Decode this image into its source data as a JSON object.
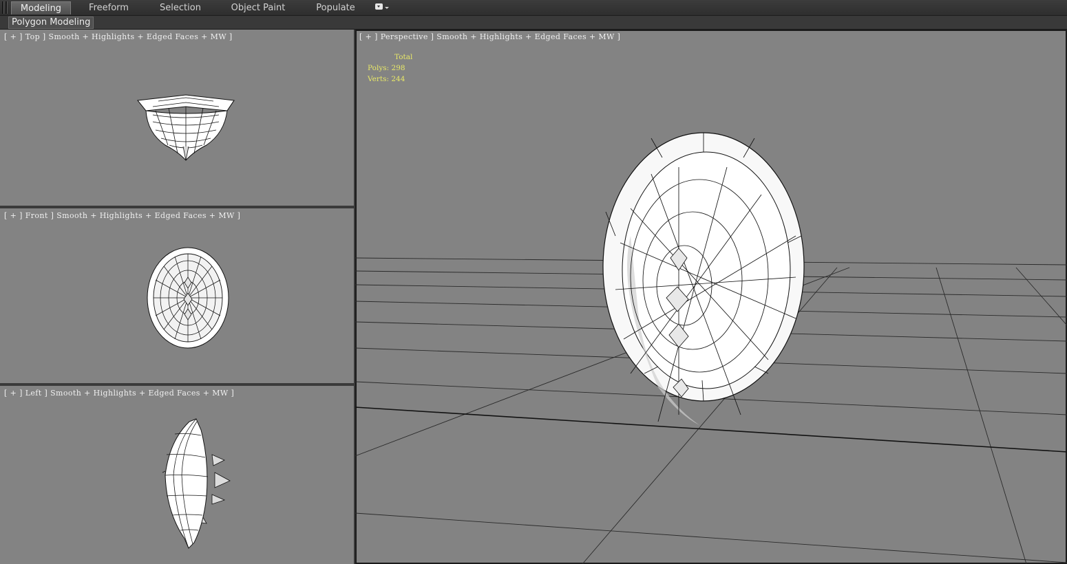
{
  "ribbon": {
    "tabs": [
      "Modeling",
      "Freeform",
      "Selection",
      "Object Paint",
      "Populate"
    ],
    "active_tab": "Modeling",
    "panel_label": "Polygon Modeling"
  },
  "viewports": {
    "top": {
      "label": "[ + ] Top ] Smooth + Highlights + Edged Faces + MW ]"
    },
    "front": {
      "label": "[ + ] Front ] Smooth + Highlights + Edged Faces + MW ]"
    },
    "left": {
      "label": "[ + ] Left ] Smooth + Highlights + Edged Faces + MW ]"
    },
    "perspective": {
      "label": "[ + ] Perspective ] Smooth + Highlights + Edged Faces + MW ]",
      "stats": {
        "header": "Total",
        "polys": "Polys: 298",
        "verts": "Verts: 244"
      }
    }
  },
  "colors": {
    "viewport_bg": "#838383",
    "stats_text": "#e8e868",
    "active_border": "#1a1a1a"
  }
}
